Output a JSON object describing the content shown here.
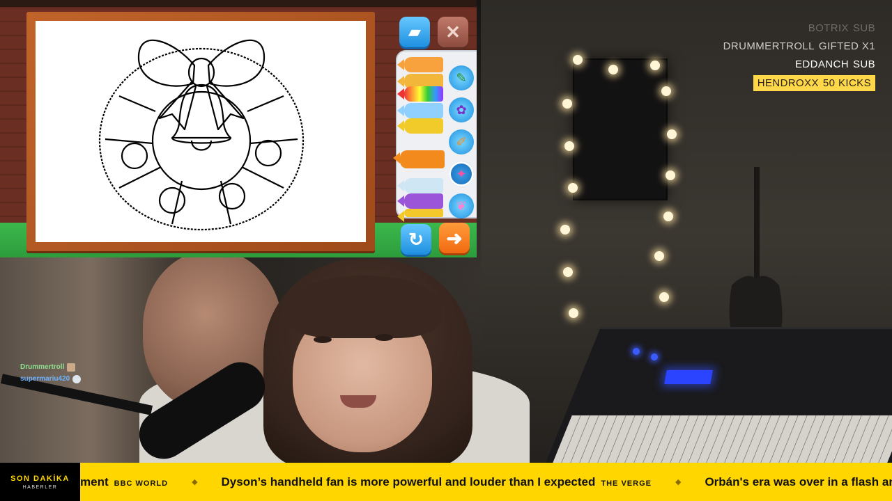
{
  "game": {
    "tools": [
      "eraser-icon",
      "close-icon",
      "undo-icon",
      "next-arrow-icon"
    ],
    "close_glyph": "✕",
    "undo_glyph": "↻",
    "next_glyph": "➜",
    "eraser_glyph": "▰"
  },
  "alerts": [
    {
      "name": "BOTRIX",
      "type": "SUB",
      "style": "faded"
    },
    {
      "name": "DRUMMERTROLL",
      "type": "GIFTED X1",
      "style": "mid"
    },
    {
      "name": "EDDANCH",
      "type": "SUB",
      "style": "bright"
    },
    {
      "name": "HENDROXX",
      "type": "50 KICKS",
      "style": "highlight"
    }
  ],
  "chat": [
    {
      "user": "Drummertroll"
    },
    {
      "user": "supermariu420"
    }
  ],
  "ticker": {
    "brand_line1": "SON DAKİKA",
    "brand_line2": "HABERLER",
    "items": [
      {
        "headline": "ment",
        "source": "BBC WORLD"
      },
      {
        "headline": "Dyson’s handheld fan is more powerful and louder than I expected",
        "source": "THE VERGE"
      },
      {
        "headline": "Orbán's era was over in a flash and H",
        "source": ""
      }
    ],
    "separator": "◆"
  },
  "colors": {
    "ticker_bg": "#ffd600",
    "alert_highlight": "#ffd84a",
    "board_frame": "#c0642a",
    "grass": "#3bb84c"
  }
}
